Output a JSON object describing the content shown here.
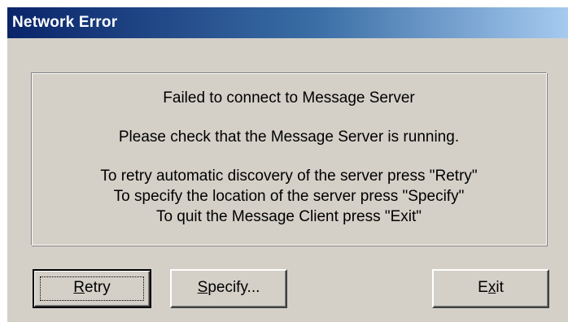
{
  "window": {
    "title": "Network Error"
  },
  "message": {
    "line1": "Failed to connect to Message Server",
    "line2": "Please check that the Message Server is running.",
    "line3": "To retry automatic discovery of the server press \"Retry\"",
    "line4": "To specify the location of the server press \"Specify\"",
    "line5": "To quit the Message Client press \"Exit\""
  },
  "buttons": {
    "retry": {
      "mnemonic": "R",
      "rest": "etry"
    },
    "specify": {
      "mnemonic": "S",
      "rest": "pecify..."
    },
    "exit": {
      "before": "E",
      "mnemonic": "x",
      "rest": "it"
    }
  },
  "colors": {
    "dialog_face": "#d4d0c8",
    "titlebar_start": "#0a246a",
    "titlebar_end": "#a6caf0"
  }
}
